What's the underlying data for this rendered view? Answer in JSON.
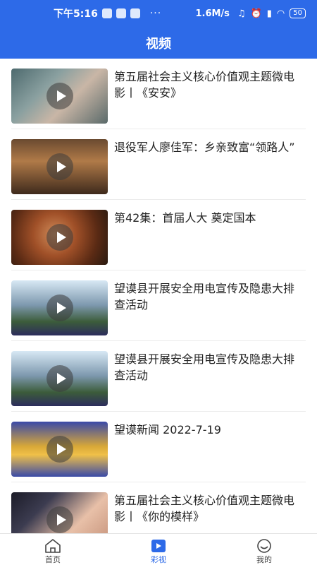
{
  "status_bar": {
    "time": "下午5:16",
    "dots": "···",
    "speed": "1.6M/s",
    "battery": "50"
  },
  "header": {
    "title": "视频"
  },
  "videos": [
    {
      "title": "第五届社会主义核心价值观主题微电影丨《安安》"
    },
    {
      "title": "退役军人廖佳军：乡亲致富“领路人”"
    },
    {
      "title": "第42集：首届人大 奠定国本"
    },
    {
      "title": "望谟县开展安全用电宣传及隐患大排查活动"
    },
    {
      "title": "望谟县开展安全用电宣传及隐患大排查活动"
    },
    {
      "title": "望谟新闻 2022-7-19"
    },
    {
      "title": "第五届社会主义核心价值观主题微电影丨《你的模样》"
    }
  ],
  "tabbar": {
    "home_label": "首页",
    "video_label": "彩视",
    "mine_label": "我的"
  },
  "colors": {
    "accent": "#2d6ae8"
  }
}
